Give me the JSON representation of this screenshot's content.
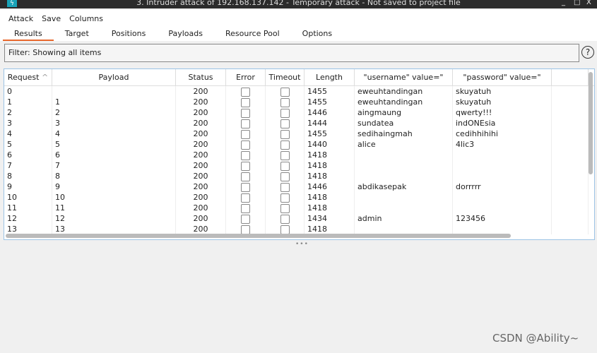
{
  "window": {
    "title": "3. Intruder attack of 192.168.137.142 - Temporary attack - Not saved to project file",
    "controls": [
      "_",
      "□",
      "X"
    ]
  },
  "menu": [
    "Attack",
    "Save",
    "Columns"
  ],
  "tabs": [
    "Results",
    "Target",
    "Positions",
    "Payloads",
    "Resource Pool",
    "Options"
  ],
  "active_tab": "Results",
  "filter": "Filter: Showing all items",
  "help": "?",
  "columns": [
    "Request",
    "Payload",
    "Status",
    "Error",
    "Timeout",
    "Length",
    "\"username\" value=\"",
    "\"password\" value=\""
  ],
  "sort": "Request ascending",
  "rows": [
    [
      "0",
      "",
      "200",
      "1455",
      "eweuhtandingan",
      "skuyatuh"
    ],
    [
      "1",
      "1",
      "200",
      "1455",
      "eweuhtandingan",
      "skuyatuh"
    ],
    [
      "2",
      "2",
      "200",
      "1446",
      "aingmaung",
      "qwerty!!!"
    ],
    [
      "3",
      "3",
      "200",
      "1444",
      "sundatea",
      "indONEsia"
    ],
    [
      "4",
      "4",
      "200",
      "1455",
      "sedihaingmah",
      "cedihhihihi"
    ],
    [
      "5",
      "5",
      "200",
      "1440",
      "alice",
      "4lic3"
    ],
    [
      "6",
      "6",
      "200",
      "1418",
      "",
      ""
    ],
    [
      "7",
      "7",
      "200",
      "1418",
      "",
      ""
    ],
    [
      "8",
      "8",
      "200",
      "1418",
      "",
      ""
    ],
    [
      "9",
      "9",
      "200",
      "1446",
      "abdikasepak",
      "dorrrrr"
    ],
    [
      "10",
      "10",
      "200",
      "1418",
      "",
      ""
    ],
    [
      "11",
      "11",
      "200",
      "1418",
      "",
      ""
    ],
    [
      "12",
      "12",
      "200",
      "1434",
      "admin",
      "123456"
    ],
    [
      "13",
      "13",
      "200",
      "1418",
      "",
      ""
    ]
  ],
  "watermark": "CSDN @Ability~",
  "colors": {
    "accent": "#e8672b",
    "title_bg": "#2b2b2b"
  }
}
